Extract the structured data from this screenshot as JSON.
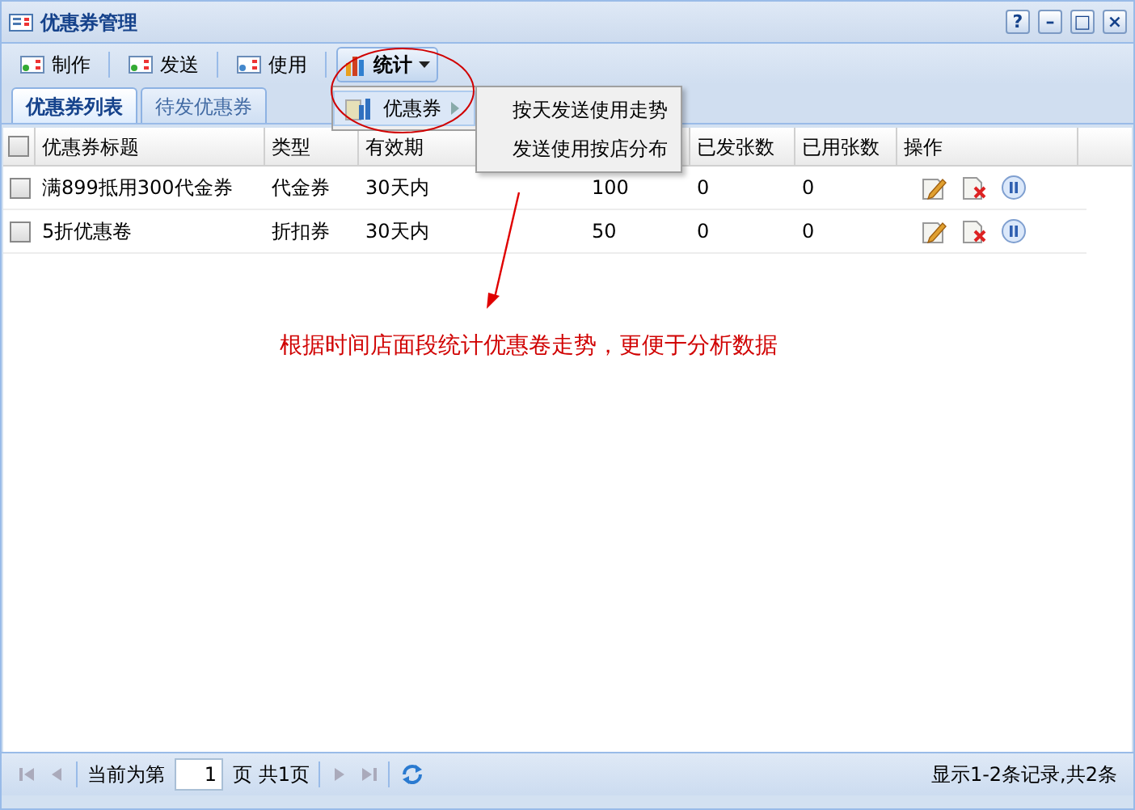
{
  "window": {
    "title": "优惠券管理",
    "controls": [
      "?",
      "–",
      "□",
      "×"
    ]
  },
  "toolbar": [
    {
      "kind": "button",
      "label": "制作",
      "pressed": false
    },
    {
      "kind": "button",
      "label": "发送",
      "pressed": false
    },
    {
      "kind": "button",
      "label": "使用",
      "pressed": false
    },
    {
      "kind": "menu",
      "label": "统计",
      "pressed": true
    }
  ],
  "tabs": [
    {
      "label": "优惠券列表",
      "selected": true
    },
    {
      "label": "待发优惠券",
      "selected": false
    }
  ],
  "menu": {
    "items": [
      {
        "label": "优惠券",
        "expanded": true
      }
    ],
    "submenu": [
      "按天发送使用走势",
      "发送使用按店分布"
    ]
  },
  "table": {
    "all_checked": false,
    "columns": [
      "优惠券标题",
      "类型",
      "有效期",
      "",
      "已发张数",
      "已用张数",
      "操作"
    ],
    "rows": [
      {
        "checked": false,
        "cells": [
          "满899抵用300代金券",
          "代金券",
          "30天内",
          "100",
          "0",
          "0"
        ]
      },
      {
        "checked": false,
        "cells": [
          "5折优惠卷",
          "折扣券",
          "30天内",
          "50",
          "0",
          "0"
        ]
      }
    ]
  },
  "annotation": "根据时间店面段统计优惠卷走势，更便于分析数据",
  "pager": {
    "before": "当前为第",
    "page": "1",
    "after": "页 共1页",
    "summary": "显示1-2条记录,共2条"
  }
}
